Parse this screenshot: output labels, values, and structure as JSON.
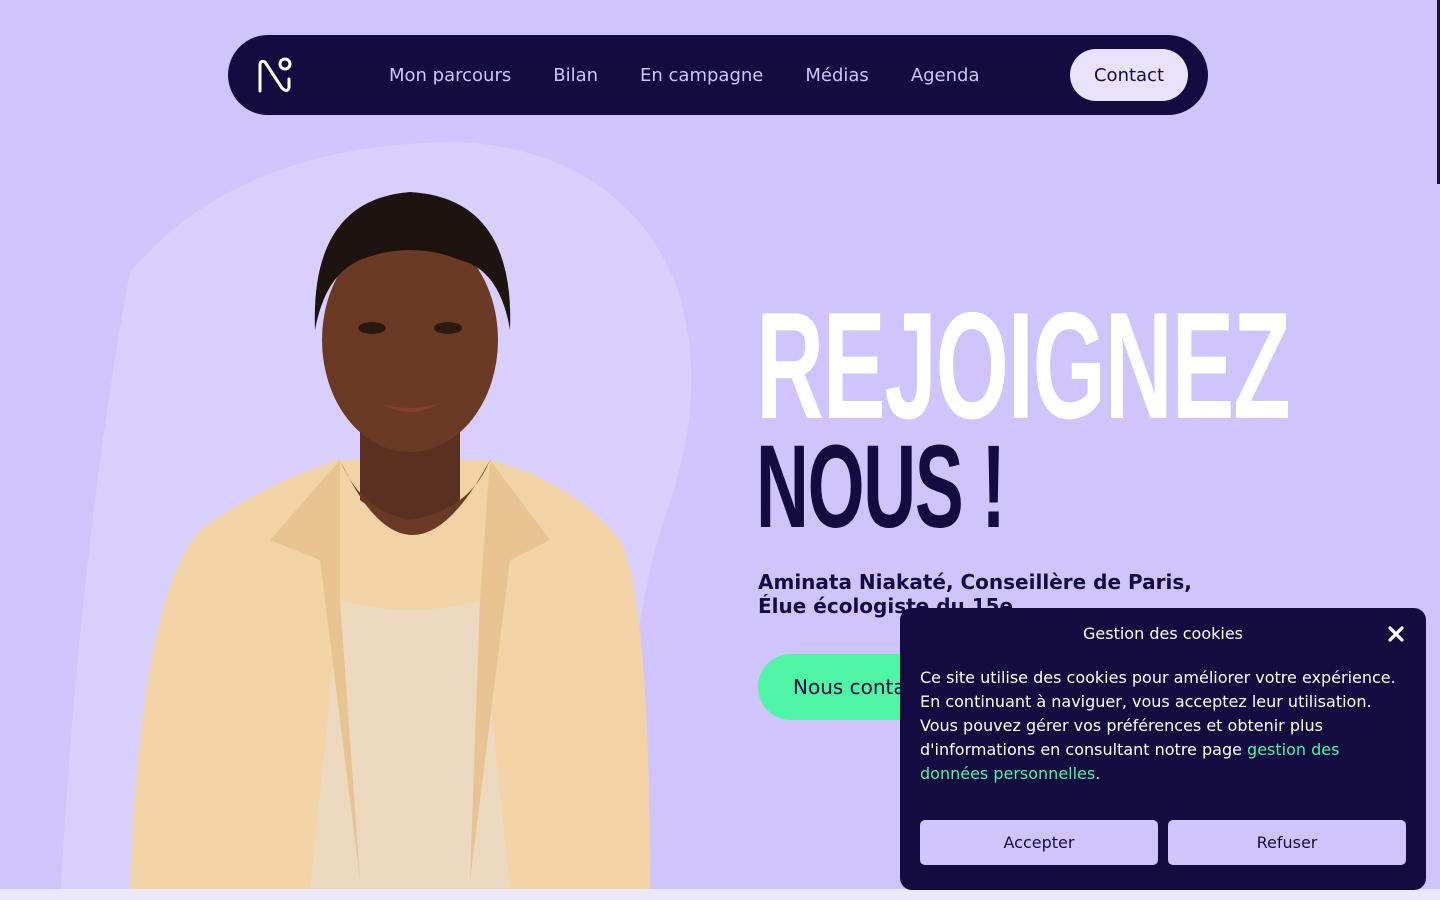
{
  "colors": {
    "background": "#cfc4fb",
    "navy": "#140c40",
    "accent_green": "#4df5a5",
    "white": "#ffffff"
  },
  "nav": {
    "logo_icon": "n-logo-icon",
    "links": [
      "Mon parcours",
      "Bilan",
      "En campagne",
      "Médias",
      "Agenda"
    ],
    "contact_label": "Contact"
  },
  "hero": {
    "headline_line1": "REJOIGNEZ",
    "headline_line2": "NOUS !",
    "subtitle_line1": "Aminata Niakaté, Conseillère de Paris,",
    "subtitle_line2": "Élue écologiste du 15e",
    "cta_label": "Nous contacter"
  },
  "cookie": {
    "title": "Gestion des cookies",
    "close_icon": "close-icon",
    "body_text": "Ce site utilise des cookies pour améliorer votre expérience. En continuant à naviguer, vous acceptez leur utilisation. Vous pouvez gérer vos préférences et obtenir plus d'informations en consultant notre page ",
    "link_text": "gestion des données personnelles",
    "body_end": ".",
    "accept_label": "Accepter",
    "refuse_label": "Refuser"
  }
}
